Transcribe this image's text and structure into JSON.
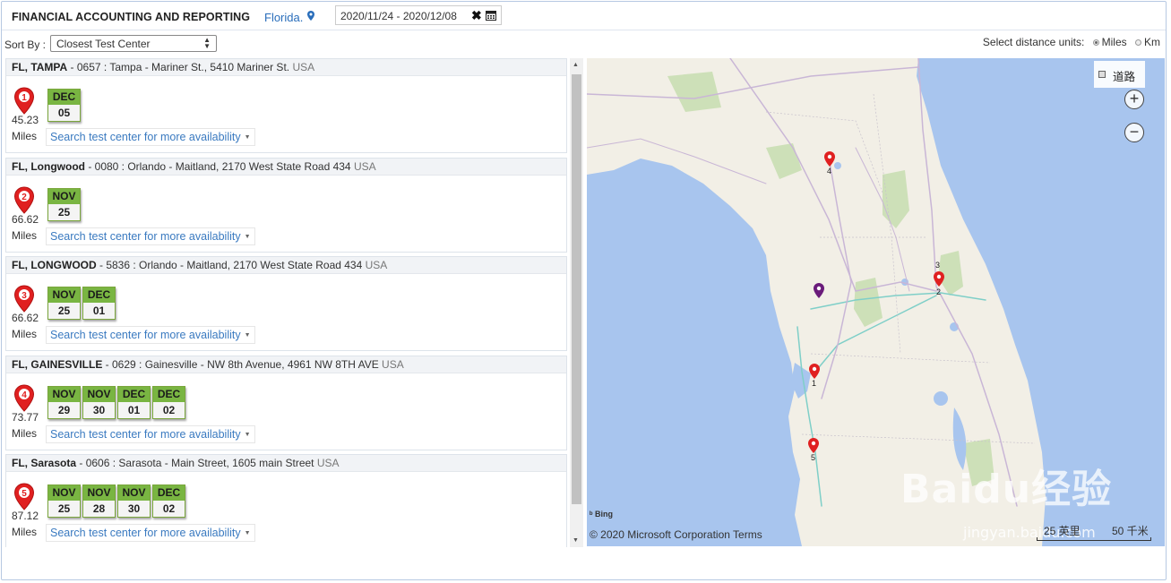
{
  "header": {
    "title": "FINANCIAL ACCOUNTING AND REPORTING",
    "location": "Florida.",
    "date_range": "2020/11/24 - 2020/12/08",
    "clear_glyph": "✖",
    "location_icon": "map-marker-icon",
    "calendar_icon": "calendar-icon"
  },
  "sort": {
    "label": "Sort By :",
    "selected": "Closest Test Center"
  },
  "units": {
    "label": "Select distance units:",
    "options": [
      {
        "label": "Miles",
        "selected": true
      },
      {
        "label": "Km",
        "selected": false
      }
    ]
  },
  "centers": [
    {
      "rank": "1",
      "name": "FL, TAMPA",
      "detail": " - 0657 : Tampa - Mariner St., 5410 Mariner St. ",
      "country": "USA",
      "distance": "45.23",
      "unit": "Miles",
      "dates": [
        {
          "month": "DEC",
          "day": "05"
        }
      ],
      "more_label": "Search test center for more availability"
    },
    {
      "rank": "2",
      "name": "FL, Longwood",
      "detail": " - 0080 : Orlando - Maitland, 2170 West State Road 434 ",
      "country": "USA",
      "distance": "66.62",
      "unit": "Miles",
      "dates": [
        {
          "month": "NOV",
          "day": "25"
        }
      ],
      "more_label": "Search test center for more availability"
    },
    {
      "rank": "3",
      "name": "FL, LONGWOOD",
      "detail": " - 5836 : Orlando - Maitland, 2170 West State Road 434 ",
      "country": "USA",
      "distance": "66.62",
      "unit": "Miles",
      "dates": [
        {
          "month": "NOV",
          "day": "25"
        },
        {
          "month": "DEC",
          "day": "01"
        }
      ],
      "more_label": "Search test center for more availability"
    },
    {
      "rank": "4",
      "name": "FL, GAINESVILLE",
      "detail": " - 0629 : Gainesville - NW 8th Avenue, 4961 NW 8TH AVE ",
      "country": "USA",
      "distance": "73.77",
      "unit": "Miles",
      "dates": [
        {
          "month": "NOV",
          "day": "29"
        },
        {
          "month": "NOV",
          "day": "30"
        },
        {
          "month": "DEC",
          "day": "01"
        },
        {
          "month": "DEC",
          "day": "02"
        }
      ],
      "more_label": "Search test center for more availability"
    },
    {
      "rank": "5",
      "name": "FL, Sarasota",
      "detail": " - 0606 : Sarasota - Main Street, 1605 main Street ",
      "country": "USA",
      "distance": "87.12",
      "unit": "Miles",
      "dates": [
        {
          "month": "NOV",
          "day": "25"
        },
        {
          "month": "NOV",
          "day": "28"
        },
        {
          "month": "NOV",
          "day": "30"
        },
        {
          "month": "DEC",
          "day": "02"
        }
      ],
      "more_label": "Search test center for more availability"
    }
  ],
  "map": {
    "layer_label": "道路",
    "zoom_in": "+",
    "zoom_out": "−",
    "pin_labels": [
      "4",
      "3",
      "2",
      "1",
      "5"
    ],
    "provider": "Bing",
    "copyright": "© 2020 Microsoft Corporation Terms",
    "scale_imperial": "25 英里",
    "scale_metric": "50 千米",
    "watermark": "Baidu经验",
    "watermark_sub": "jingyan.baidu.com"
  },
  "colors": {
    "accent_blue": "#2a6ebb",
    "date_green": "#79b542",
    "pin_red": "#e02020",
    "origin_pin": "#6a1b7a",
    "water": "#a8c5ee",
    "land": "#f2efe6"
  }
}
